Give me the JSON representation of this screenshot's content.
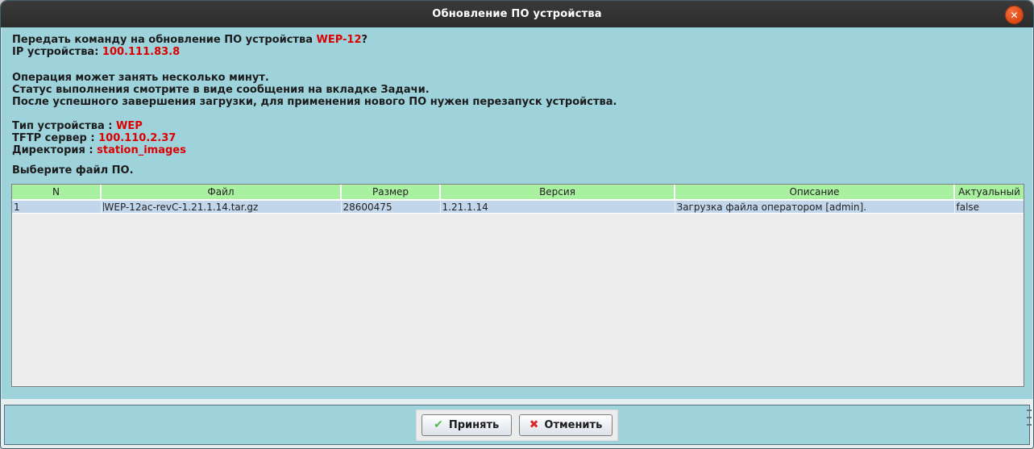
{
  "titlebar": {
    "title": "Обновление ПО устройства",
    "close_icon": "✕"
  },
  "dialog": {
    "question_prefix": "Передать команду на обновление ПО устройства ",
    "question_device": "WEP-12",
    "question_suffix": "?",
    "ip_label": "IP устройства: ",
    "ip_value": "100.111.83.8",
    "notes": [
      "Операция может занять несколько минут.",
      "Статус выполнения смотрите в виде сообщения на вкладке Задачи.",
      "После успешного завершения загрузки, для применения нового ПО нужен перезапуск устройства."
    ],
    "params": [
      {
        "label": "Тип устройства : ",
        "value": "WEP"
      },
      {
        "label": "TFTP сервер : ",
        "value": "100.110.2.37"
      },
      {
        "label": "Директория : ",
        "value": "station_images"
      }
    ],
    "select_prompt": "Выберите файл ПО."
  },
  "table": {
    "columns": [
      "N",
      "Файл",
      "Размер",
      "Версия",
      "Описание",
      "Актуальный"
    ],
    "rows": [
      [
        "1",
        "WEP-12ac-revC-1.21.1.14.tar.gz",
        "28600475",
        "1.21.1.14",
        "Загрузка файла оператором [admin].",
        "false"
      ]
    ]
  },
  "buttons": {
    "accept_icon": "✔",
    "accept_label": "Принять",
    "cancel_icon": "✖",
    "cancel_label": "Отменить"
  },
  "colors": {
    "dialog_teal": "#9ed3dc",
    "titlebar_dark": "#2e2e2e",
    "close_orange": "#dd4814",
    "highlight_red": "#dd0000",
    "table_header_green": "#a9f0a0",
    "row_selected_blue": "#c1d5eb",
    "table_empty_gray": "#ededed",
    "footer_light": "#e7eef0"
  }
}
